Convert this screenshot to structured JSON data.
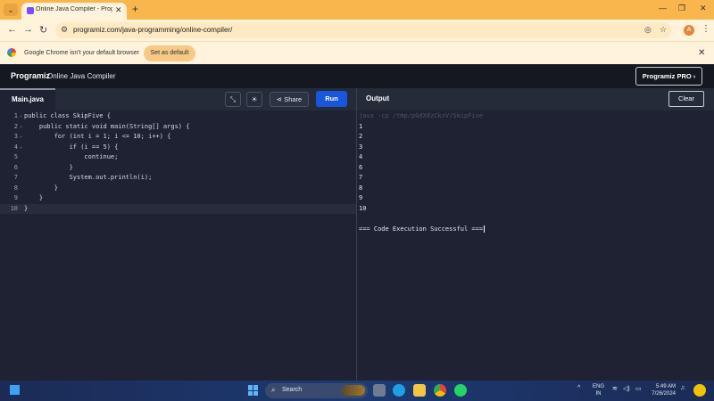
{
  "browser": {
    "tab_title": "Online Java Compiler - Program",
    "url": "programiz.com/java-programming/online-compiler/",
    "profile_initial": "A",
    "infobar_message": "Google Chrome isn't your default browser",
    "set_default_label": "Set as default"
  },
  "app": {
    "logo": "Programiz",
    "title": "Online Java Compiler",
    "pro_button": "Programiz PRO ›"
  },
  "editor": {
    "file_tab": "Main.java",
    "share_label": "Share",
    "run_label": "Run",
    "lines": [
      {
        "n": "1",
        "code": "public class SkipFive {",
        "fold": true
      },
      {
        "n": "2",
        "code": "    public static void main(String[] args) {",
        "fold": true
      },
      {
        "n": "3",
        "code": "        for (int i = 1; i <= 10; i++) {",
        "fold": true
      },
      {
        "n": "4",
        "code": "            if (i == 5) {",
        "fold": true
      },
      {
        "n": "5",
        "code": "                continue;",
        "fold": false
      },
      {
        "n": "6",
        "code": "            }",
        "fold": false
      },
      {
        "n": "7",
        "code": "            System.out.println(i);",
        "fold": false
      },
      {
        "n": "8",
        "code": "        }",
        "fold": false
      },
      {
        "n": "9",
        "code": "    }",
        "fold": false
      },
      {
        "n": "10",
        "code": "}",
        "fold": false
      }
    ]
  },
  "output": {
    "title": "Output",
    "clear_label": "Clear",
    "command": "java -cp /tmp/pGdX8zCkxV/SkipFive",
    "lines": [
      "1",
      "2",
      "3",
      "4",
      "6",
      "7",
      "8",
      "9",
      "10",
      "",
      "=== Code Execution Successful ==="
    ]
  },
  "taskbar": {
    "search_label": "Search",
    "lang_line1": "ENG",
    "lang_line2": "IN",
    "time": "5:49 AM",
    "date": "7/26/2024"
  },
  "colors": {
    "run_button": "#1a56db",
    "chrome_frame": "#f8b64c",
    "editor_bg": "#1e2233"
  }
}
